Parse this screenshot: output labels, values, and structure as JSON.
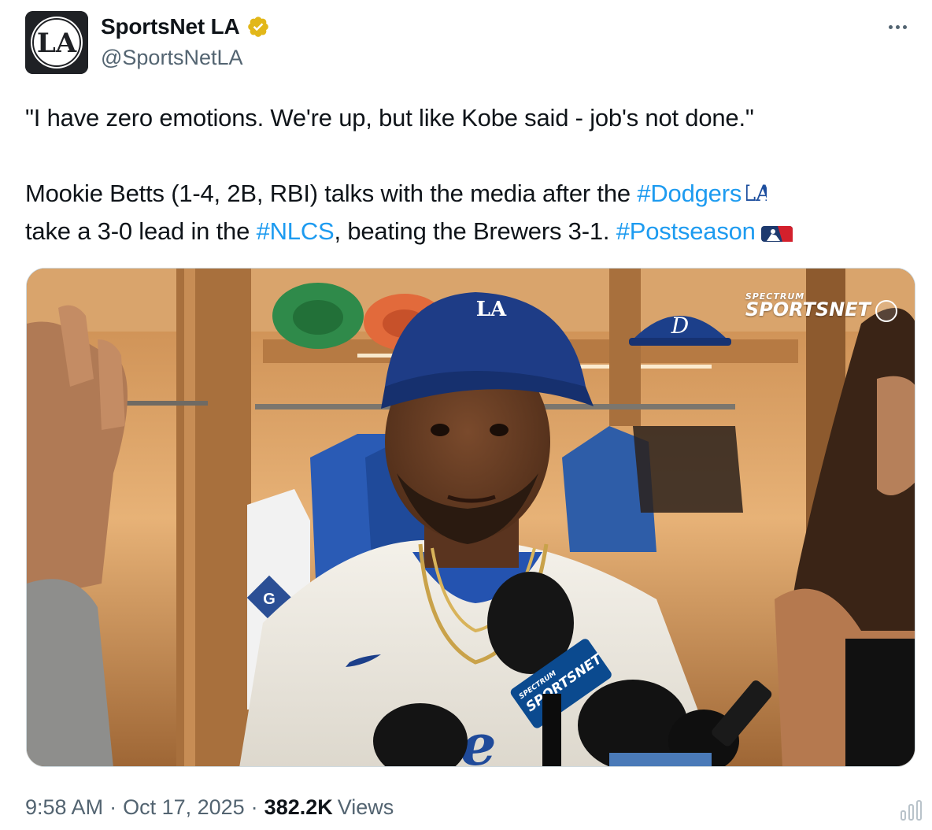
{
  "author": {
    "display_name": "SportsNet LA",
    "handle": "@SportsNetLA",
    "verified": true,
    "avatar_icon": "la-logo-icon",
    "verified_color": "#e2b719"
  },
  "tweet": {
    "quote": "\"I have zero emotions. We're up, but like Kobe said - job's not done.\"",
    "line1_text": "Mookie Betts (1-4, 2B, RBI) talks with the media after the ",
    "hashtag_dodgers": "#Dodgers",
    "line2_text_a": "take a 3-0 lead in the ",
    "hashtag_nlcs": "#NLCS",
    "line2_text_b": ", beating the Brewers 3-1. ",
    "hashtag_postseason": "#Postseason",
    "inline_icons": [
      "la-logo-icon",
      "mlb-logo-icon"
    ],
    "hashtag_color": "#1d9bf0"
  },
  "media": {
    "watermark_top": "SPECTRUM",
    "watermark_main": "SPORTSNET",
    "mic_flag_top": "SPECTRUM",
    "mic_flag_main": "SPORTSNET",
    "cap_logo": "LA",
    "jersey_text": "dge",
    "locker_badge": "G"
  },
  "footer": {
    "time": "9:58 AM",
    "separator": "·",
    "date": "Oct 17, 2025",
    "views_count": "382.2K",
    "views_label": "Views",
    "chart_icon": "analytics-icon"
  }
}
